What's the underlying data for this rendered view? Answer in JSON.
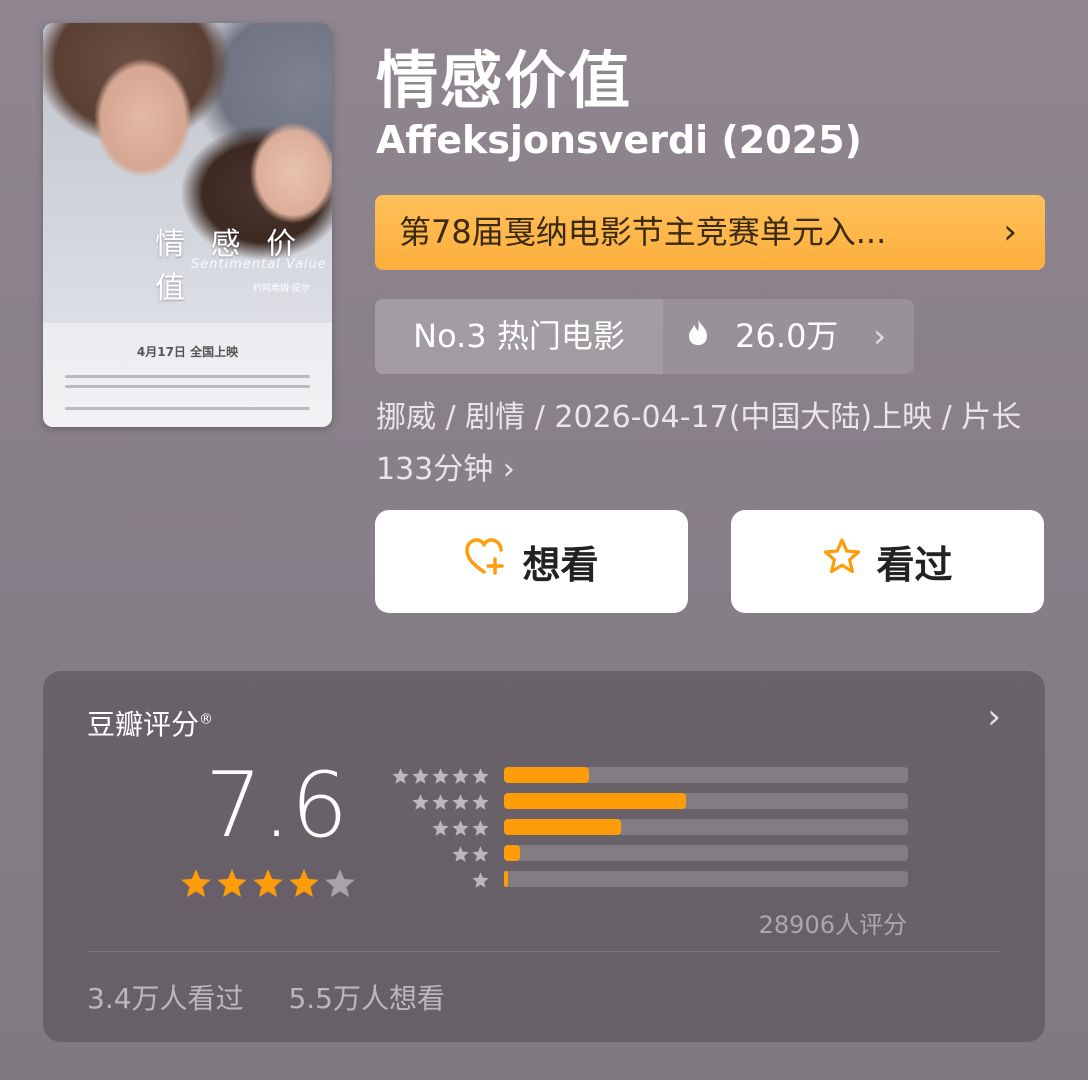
{
  "movie": {
    "title": "情感价值",
    "original_title": "Affeksjonsverdi (2025)",
    "award_banner": "第78届戛纳电影节主竞赛单元入...",
    "rank_label": "No.3 热门电影",
    "heat_value": "26.0万",
    "meta_line": "挪威 / 剧情 / 2026-04-17(中国大陆)上映 / 片长133分钟",
    "poster": {
      "title": "情 感 价 值",
      "subtitle": "Sentimental Value",
      "director": "约阿希姆·提尔",
      "release": "4月17日 全国上映"
    }
  },
  "actions": {
    "want_label": "想看",
    "seen_label": "看过"
  },
  "rating": {
    "source_label": "豆瓣评分",
    "score": "7.6",
    "stars_filled": 4,
    "stars_total": 5,
    "distribution": [
      {
        "stars": 5,
        "fraction": 0.21
      },
      {
        "stars": 4,
        "fraction": 0.45
      },
      {
        "stars": 3,
        "fraction": 0.29
      },
      {
        "stars": 2,
        "fraction": 0.04
      },
      {
        "stars": 1,
        "fraction": 0.01
      }
    ],
    "count_text": "28906人评分",
    "seen_text": "3.4万人看过",
    "want_text": "5.5万人想看"
  },
  "colors": {
    "accent_orange": "#ff9c0a",
    "award_bg": "#fcaf3d",
    "star_empty": "#a8a3a9"
  }
}
